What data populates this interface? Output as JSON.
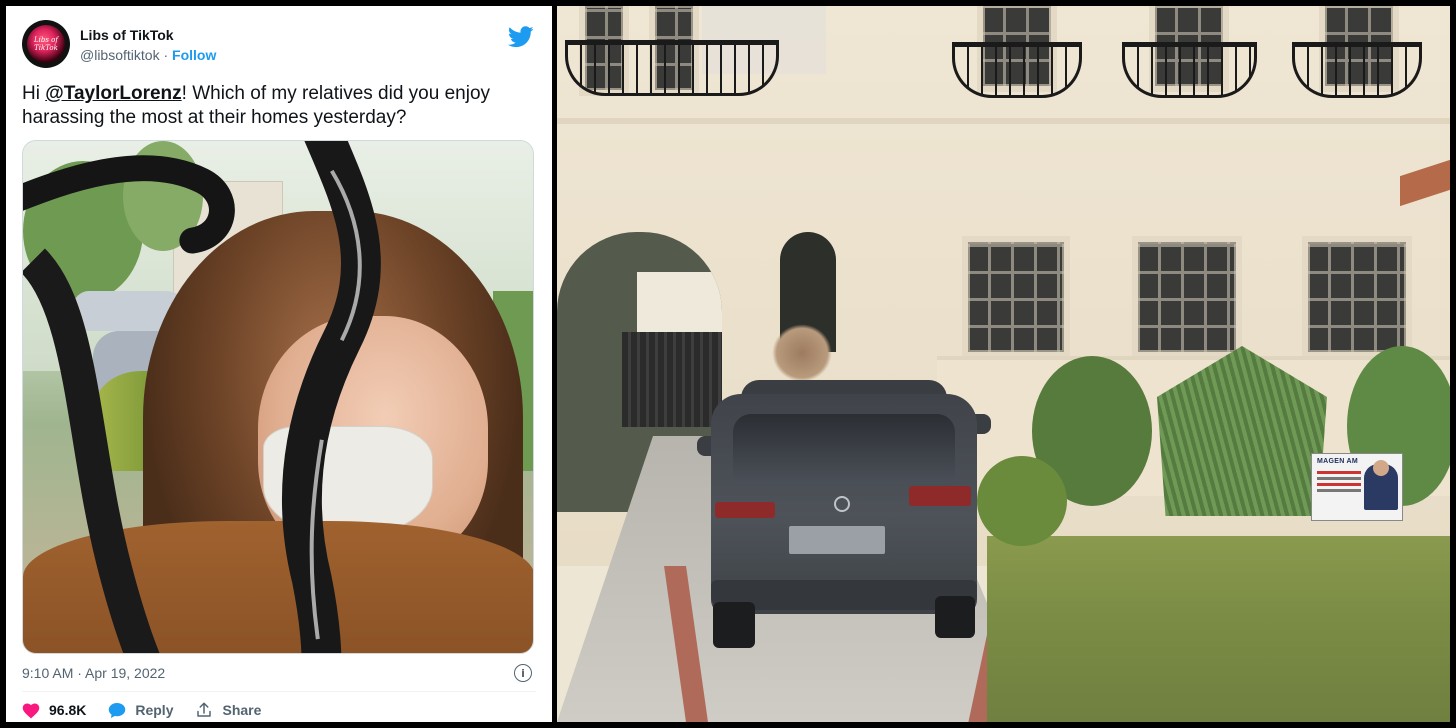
{
  "tweet": {
    "display_name": "Libs of TikTok",
    "avatar_text": "Libs of TikTok",
    "handle": "@libsoftiktok",
    "separator": " · ",
    "follow_label": "Follow",
    "text_prefix": "Hi ",
    "mention": "@TaylorLorenz",
    "text_suffix": "! Which of my relatives did you enjoy harassing the most at their homes yesterday?",
    "timestamp": "9:10 AM · Apr 19, 2022",
    "info_symbol": "i",
    "likes": "96.8K",
    "reply_label": "Reply",
    "share_label": "Share",
    "colors": {
      "brand": "#1d9bf0",
      "like": "#f91880",
      "text": "#0f1419",
      "muted": "#536471"
    },
    "icons": [
      "twitter-bird-icon",
      "heart-icon",
      "reply-icon",
      "share-icon",
      "info-icon"
    ]
  },
  "street_photo": {
    "sign_title": "MAGEN AM"
  }
}
